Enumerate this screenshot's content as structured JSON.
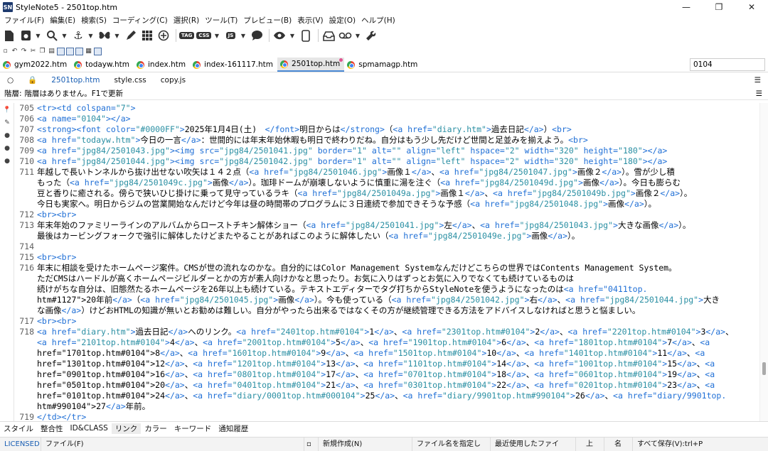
{
  "window": {
    "title": "StyleNote5 - 2501top.htm",
    "logo": "SN",
    "minimize_icon": "—",
    "maximize_icon": "❐",
    "close_icon": "✕"
  },
  "menu": [
    "ファイル(F)",
    "編集(E)",
    "検索(S)",
    "コーディング(C)",
    "選択(R)",
    "ツール(T)",
    "プレビュー(B)",
    "表示(V)",
    "設定(O)",
    "ヘルプ(H)"
  ],
  "toolbar": {
    "tag_label": "TAG",
    "css_label": "CSS",
    "js_label": "JS"
  },
  "file_tabs": [
    {
      "label": "gym2022.htm",
      "active": false
    },
    {
      "label": "todayw.htm",
      "active": false
    },
    {
      "label": "index.htm",
      "active": false
    },
    {
      "label": "index-161117.htm",
      "active": false
    },
    {
      "label": "2501top.htm",
      "active": true
    },
    {
      "label": "spmamagp.htm",
      "active": false
    }
  ],
  "search": {
    "value": "0104"
  },
  "sub_tabs": [
    "2501top.htm",
    "style.css",
    "copy.js"
  ],
  "status_line": {
    "label": "階層:",
    "text": "階層はありません。F1で更新"
  },
  "editor_rows": [
    {
      "ln": "705",
      "text": "<tr><td colspan=\"7\">"
    },
    {
      "ln": "706",
      "text": "<a name=\"0104\"></a>"
    },
    {
      "ln": "707",
      "text": "<strong><font color=\"#0000FF\">2025年1月4日(土)　</font>明日からは</strong>（<a href=\"diary.htm\">過去日記</a>）<br>"
    },
    {
      "ln": "708",
      "text": "<a href=\"todayw.htm\">今日の一言</a>：世間的には年末年始休暇も明日で終わりだね。自分はもう少し先だけど世間と足並みを揃えよう。<br>"
    },
    {
      "ln": "709",
      "text": "<a href=\"jpg84/2501043.jpg\"><img src=\"jpg84/2501041.jpg\" border=\"1\" alt=\"\" align=\"left\" hspace=\"2\" width=\"320\" height=\"180\"></a>"
    },
    {
      "ln": "710",
      "text": "<a href=\"jpg84/2501044.jpg\"><img src=\"jpg84/2501042.jpg\" border=\"1\" alt=\"\" align=\"left\" hspace=\"2\" width=\"320\" height=\"180\"></a>"
    },
    {
      "ln": "711",
      "text": "年越しで長いトンネルから抜け出せない吹矢は１４２点（<a href=\"jpg84/2501046.jpg\">画像１</a>、<a href=\"jpg84/2501047.jpg\">画像２</a>）。雪が少し積"
    },
    {
      "ln": "",
      "text": "もった（<a href=\"jpg84/2501049c.jpg\">画像</a>）。珈琲ドームが崩壊しないように慎重に湯を注ぐ（<a href=\"jpg84/2501049d.jpg\">画像</a>）。今日も膨らむ"
    },
    {
      "ln": "",
      "text": "豆と香りに癒される。傍らで狭いひじ掛けに乗って見守っているラキ（<a href=\"jpg84/2501049a.jpg\">画像１</a>、<a href=\"jpg84/2501049b.jpg\">画像２</a>）。"
    },
    {
      "ln": "",
      "text": "今日も実家へ。明日からジムの営業開始なんだけど今年は昼の時間帯のプログラムに３日連続で参加できそうな予感（<a href=\"jpg84/2501048.jpg\">画像</a>）。"
    },
    {
      "ln": "712",
      "text": "<br><br>"
    },
    {
      "ln": "713",
      "text": "年末年始のファミリーラインのアルバムからローストチキン解体ショー（<a href=\"jpg84/2501041.jpg\">左</a>、<a href=\"jpg84/2501043.jpg\">大きな画像</a>）。"
    },
    {
      "ln": "",
      "text": "最後はカービングフォークで強引に解体したけどまたやることがあればこのように解体したい（<a href=\"jpg84/2501049e.jpg\">画像</a>）。"
    },
    {
      "ln": "714",
      "text": ""
    },
    {
      "ln": "715",
      "text": "<br><br>"
    },
    {
      "ln": "716",
      "text": "年末に相談を受けたホームページ案件。CMSが世の流れなのかな。自分的にはColor Management Systemなんだけどこちらの世界ではContents Management System。"
    },
    {
      "ln": "",
      "text": "ただCMSはハードルが高くホームページビルダーとかの方が素人向けかなと思ったり。お気に入りはずっとお気に入りでなくても続けているものは"
    },
    {
      "ln": "",
      "text": "続けがちな自分は、旧態然たるホームページを26年以上も続けている。テキストエディターでタグ打ちからStyleNoteを使うようになったのは<a href=\"0411top."
    },
    {
      "ln": "",
      "text": "htm#1127\">20年前</a>（<a href=\"jpg84/2501045.jpg\">画像</a>）。今も使っている（<a href=\"jpg84/2501042.jpg\">右</a>、<a href=\"jpg84/2501044.jpg\">大き"
    },
    {
      "ln": "",
      "text": "な画像</a>）けどおHTMLの知識が無いとお勧めは難しい。自分がやったら出来るではなくその方が継続管理できる方法をアドバイスしなければと思うと悩ましい。"
    },
    {
      "ln": "717",
      "text": "<br><br>"
    },
    {
      "ln": "718",
      "text": "<a href=\"diary.htm\">過去日記</a>へのリンク。<a href=\"2401top.htm#0104\">1</a>、<a href=\"2301top.htm#0104\">2</a>、<a href=\"2201top.htm#0104\">3</a>、"
    },
    {
      "ln": "",
      "text": "<a href=\"2101top.htm#0104\">4</a>、<a href=\"2001top.htm#0104\">5</a>、<a href=\"1901top.htm#0104\">6</a>、<a href=\"1801top.htm#0104\">7</a>、<a"
    },
    {
      "ln": "",
      "text": "href=\"1701top.htm#0104\">8</a>、<a href=\"1601top.htm#0104\">9</a>、<a href=\"1501top.htm#0104\">10</a>、<a href=\"1401top.htm#0104\">11</a>、<a"
    },
    {
      "ln": "",
      "text": "href=\"1301top.htm#0104\">12</a>、<a href=\"1201top.htm#0104\">13</a>、<a href=\"1101top.htm#0104\">14</a>、<a href=\"1001top.htm#0104\">15</a>、<a"
    },
    {
      "ln": "",
      "text": "href=\"0901top.htm#0104\">16</a>、<a href=\"0801top.htm#0104\">17</a>、<a href=\"0701top.htm#0104\">18</a>、<a href=\"0601top.htm#0104\">19</a>、<a"
    },
    {
      "ln": "",
      "text": "href=\"0501top.htm#0104\">20</a>、<a href=\"0401top.htm#0104\">21</a>、<a href=\"0301top.htm#0104\">22</a>、<a href=\"0201top.htm#0104\">23</a>、<a"
    },
    {
      "ln": "",
      "text": "href=\"0101top.htm#0104\">24</a>、<a href=\"diary/0001top.htm#000104\">25</a>、<a href=\"diary/9901top.htm#990104\">26</a>、<a href=\"diary/9901top."
    },
    {
      "ln": "",
      "text": "htm#990104\">27</a>年前。"
    },
    {
      "ln": "719",
      "text": "</td></tr>"
    }
  ],
  "bottom_tabs": [
    "スタイル",
    "整合性",
    "ID&CLASS",
    "リンク",
    "カラー",
    "キーワード",
    "通知履歴"
  ],
  "status_bar": {
    "license": "LICENSED",
    "file_menu": "ファイル(F)",
    "new_file": "新規作成(N)",
    "specify_name": "ファイル名を指定し",
    "recent_file": "最近使用したファイ",
    "up": "上",
    "name": "名",
    "save_all": "すべて保存(V):trl+P"
  },
  "colors": {
    "tag": "#1f6fd6",
    "attr": "#1a4fb0",
    "value": "#2a8fa3",
    "text": "#000000",
    "accent": "#1a5fb4"
  }
}
